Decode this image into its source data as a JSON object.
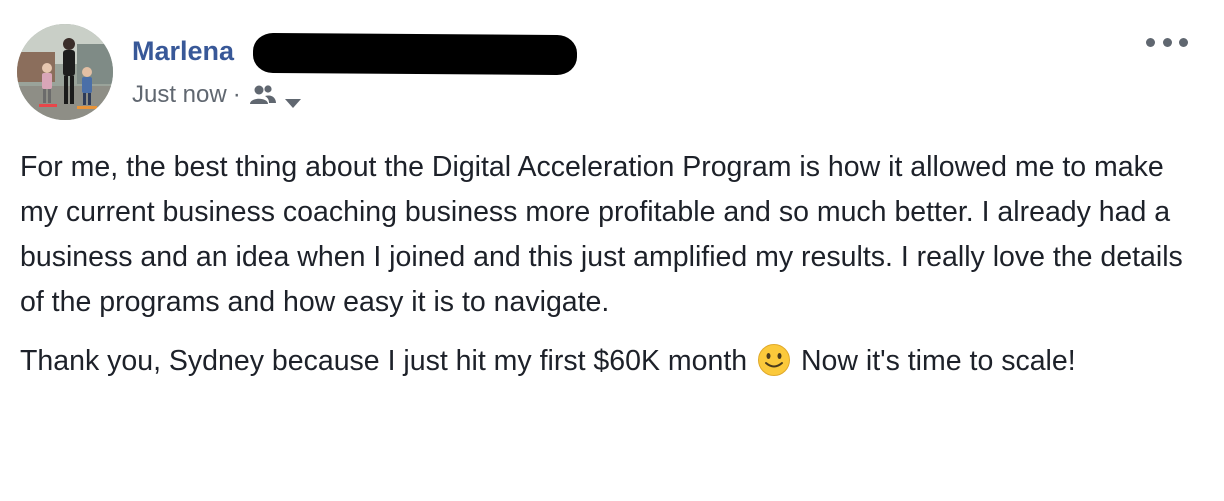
{
  "post": {
    "author_name": "Marlena",
    "timestamp": "Just now",
    "separator": "·",
    "audience_icon": "friends-icon",
    "menu_icon": "more-options-icon",
    "paragraphs": {
      "p1": "For me, the best thing about the Digital Acceleration Program is how it allowed me to make my current business coaching business more profitable and so much better. I already had a business and an idea when I joined and this just amplified my results. I really love the details of the programs and how easy it is to navigate.",
      "p2_before_emoji": "Thank you, Sydney because I just hit my first $60K month",
      "p2_emoji": "slightly-smiling-face",
      "p2_after_emoji": "Now it's time to scale!"
    }
  },
  "colors": {
    "author_link": "#385898",
    "meta_text": "#606770",
    "body_text": "#1d2129",
    "emoji_yellow": "#fbc93b",
    "redaction": "#000000"
  }
}
